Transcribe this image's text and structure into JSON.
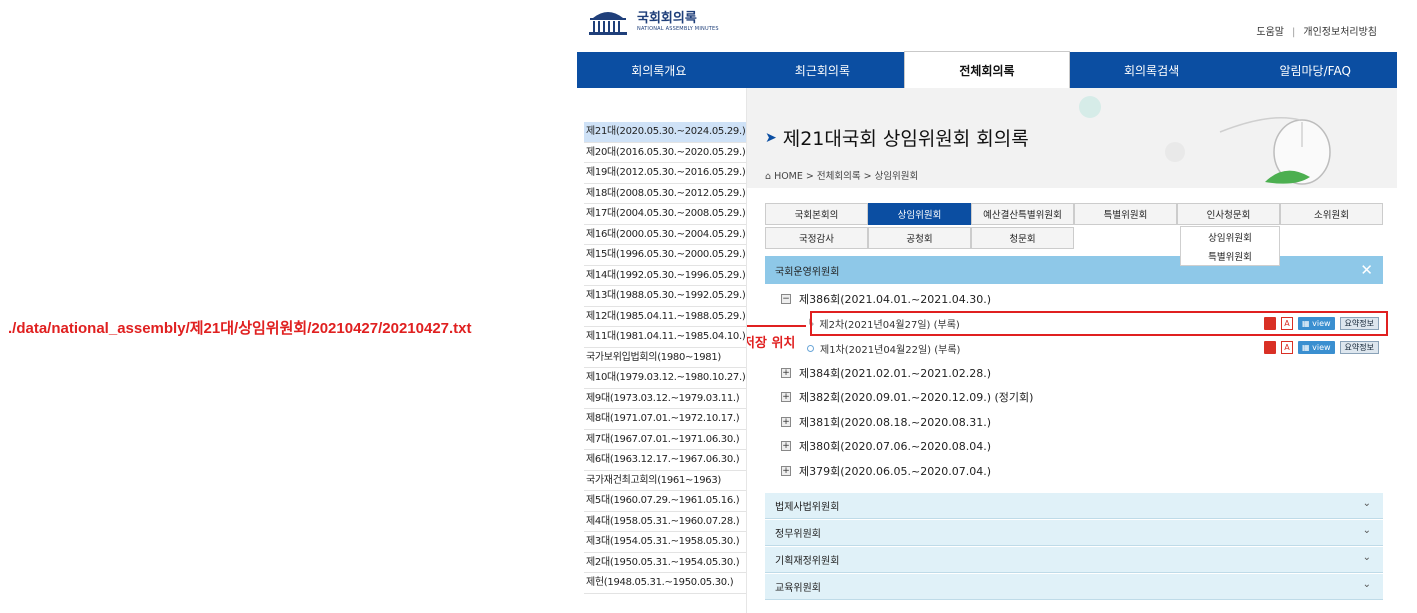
{
  "annotation": {
    "path": "./data/national_assembly/제21대/상임위원회/20210427/20210427.txt",
    "label": "저장 위치"
  },
  "header": {
    "logo_ko": "국회회의록",
    "logo_en": "NATIONAL ASSEMBLY MINUTES",
    "links": [
      "도움말",
      "개인정보처리방침"
    ]
  },
  "gnb": [
    "회의록개요",
    "최근회의록",
    "전체회의록",
    "회의록검색",
    "알림마당/FAQ"
  ],
  "sidebar": [
    "제21대(2020.05.30.~2024.05.29.)",
    "제20대(2016.05.30.~2020.05.29.)",
    "제19대(2012.05.30.~2016.05.29.)",
    "제18대(2008.05.30.~2012.05.29.)",
    "제17대(2004.05.30.~2008.05.29.)",
    "제16대(2000.05.30.~2004.05.29.)",
    "제15대(1996.05.30.~2000.05.29.)",
    "제14대(1992.05.30.~1996.05.29.)",
    "제13대(1988.05.30.~1992.05.29.)",
    "제12대(1985.04.11.~1988.05.29.)",
    "제11대(1981.04.11.~1985.04.10.)",
    "국가보위입법회의(1980~1981)",
    "제10대(1979.03.12.~1980.10.27.)",
    "제9대(1973.03.12.~1979.03.11.)",
    "제8대(1971.07.01.~1972.10.17.)",
    "제7대(1967.07.01.~1971.06.30.)",
    "제6대(1963.12.17.~1967.06.30.)",
    "국가재건최고회의(1961~1963)",
    "제5대(1960.07.29.~1961.05.16.)",
    "제4대(1958.05.31.~1960.07.28.)",
    "제3대(1954.05.31.~1958.05.30.)",
    "제2대(1950.05.31.~1954.05.30.)",
    "제헌(1948.05.31.~1950.05.30.)"
  ],
  "page": {
    "title": "제21대국회 상임위원회 회의록",
    "breadcrumb": "HOME > 전체회의록 > 상임위원회"
  },
  "tabs_row1": [
    "국회본회의",
    "상임위원회",
    "예산결산특별위원회",
    "특별위원회",
    "인사청문회",
    "소위원회"
  ],
  "tabs_row2": [
    "국정감사",
    "공청회",
    "청문회"
  ],
  "dropdown": [
    "상임위원회",
    "특별위원회"
  ],
  "committee": "국회운영위원회",
  "tree": [
    {
      "label": "제386회(2021.04.01.~2021.04.30.)",
      "open": true
    },
    {
      "label": "제384회(2021.02.01.~2021.02.28.)"
    },
    {
      "label": "제382회(2020.09.01.~2020.12.09.) (정기회)"
    },
    {
      "label": "제381회(2020.08.18.~2020.08.31.)"
    },
    {
      "label": "제380회(2020.07.06.~2020.08.04.)"
    },
    {
      "label": "제379회(2020.06.05.~2020.07.04.)"
    }
  ],
  "sessions": [
    {
      "label": "제2차(2021년04월27일) (부록)"
    },
    {
      "label": "제1차(2021년04월22일) (부록)"
    }
  ],
  "doc_buttons": {
    "view": "view",
    "summary": "요약정보"
  },
  "accordions": [
    "법제사법위원회",
    "정무위원회",
    "기획재정위원회",
    "교육위원회"
  ]
}
